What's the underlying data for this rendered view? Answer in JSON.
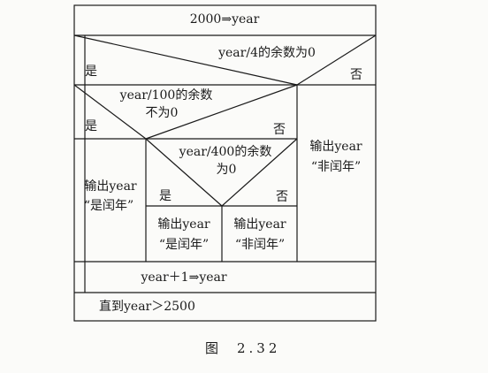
{
  "diagram": {
    "init": "2000⇒year",
    "cond1": {
      "text": "year/4的余数为0",
      "yes": "是",
      "no": "否"
    },
    "cond2": {
      "line1": "year/100的余数",
      "line2": "不为0",
      "yes": "是",
      "no": "否"
    },
    "cond3": {
      "line1": "year/400的余数",
      "line2": "为0",
      "yes": "是",
      "no": "否"
    },
    "out_leap_a": {
      "line1": "输出year",
      "line2": "“是闰年”"
    },
    "out_leap_b": {
      "line1": "输出year",
      "line2": "“是闰年”"
    },
    "out_notleap_b": {
      "line1": "输出year",
      "line2": "“非闰年”"
    },
    "out_notleap_a": {
      "line1": "输出year",
      "line2": "“非闰年”"
    },
    "increment": "year＋1⇒year",
    "loop_until": "直到year＞2500"
  },
  "caption": {
    "label": "图",
    "number": "2.32"
  }
}
